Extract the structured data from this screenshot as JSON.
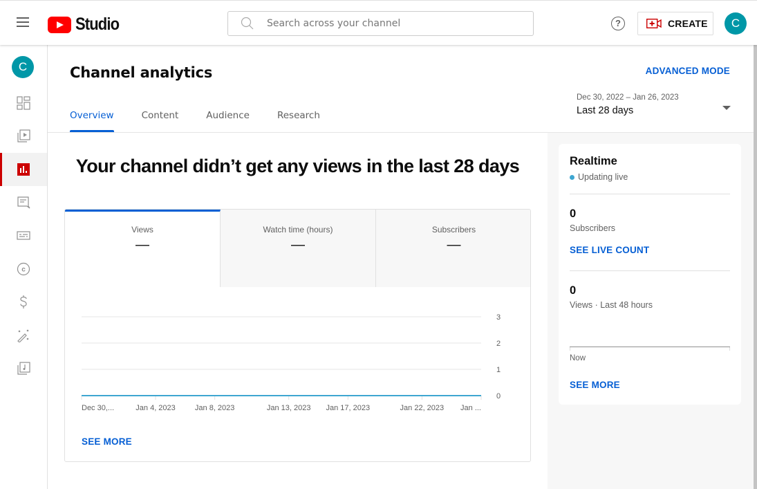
{
  "header": {
    "logo_text": "Studio",
    "search_placeholder": "Search across your channel",
    "create_label": "CREATE",
    "avatar_initial": "C",
    "colors": {
      "brand_red": "#ff0000",
      "accent_blue": "#065fd4",
      "avatar_teal": "#0097a7"
    }
  },
  "sidebar": {
    "avatar_initial": "C",
    "items": [
      {
        "name": "dashboard",
        "icon": "dashboard-icon",
        "active": false
      },
      {
        "name": "content",
        "icon": "video-library-icon",
        "active": false
      },
      {
        "name": "analytics",
        "icon": "analytics-icon",
        "active": true
      },
      {
        "name": "comments",
        "icon": "comments-icon",
        "active": false
      },
      {
        "name": "subtitles",
        "icon": "subtitles-icon",
        "active": false
      },
      {
        "name": "copyright",
        "icon": "copyright-icon",
        "active": false
      },
      {
        "name": "earn",
        "icon": "dollar-icon",
        "active": false
      },
      {
        "name": "customization",
        "icon": "magic-wand-icon",
        "active": false
      },
      {
        "name": "audio-library",
        "icon": "audio-library-icon",
        "active": false
      }
    ]
  },
  "page": {
    "title": "Channel analytics",
    "advanced_mode": "ADVANCED MODE",
    "tabs": [
      {
        "label": "Overview",
        "active": true
      },
      {
        "label": "Content",
        "active": false
      },
      {
        "label": "Audience",
        "active": false
      },
      {
        "label": "Research",
        "active": false
      }
    ],
    "date_range": "Dec 30, 2022 – Jan 26, 2023",
    "date_preset": "Last 28 days"
  },
  "overview": {
    "headline": "Your channel didn’t get any views in the last 28 days",
    "metrics": [
      {
        "label": "Views",
        "value": "—",
        "active": true
      },
      {
        "label": "Watch time (hours)",
        "value": "—",
        "active": false
      },
      {
        "label": "Subscribers",
        "value": "—",
        "active": false
      }
    ],
    "see_more": "SEE MORE"
  },
  "chart_data": {
    "type": "line",
    "title": "",
    "xlabel": "",
    "ylabel": "Views",
    "x_tick_labels": [
      "Dec 30,...",
      "Jan 4, 2023",
      "Jan 8, 2023",
      "Jan 13, 2023",
      "Jan 17, 2023",
      "Jan 22, 2023",
      "Jan ..."
    ],
    "x_tick_days": [
      0,
      5,
      9,
      14,
      18,
      23,
      27
    ],
    "y_ticks": [
      0,
      1,
      2,
      3
    ],
    "ylim": [
      0,
      3
    ],
    "grid": true,
    "series": [
      {
        "name": "Views",
        "color": "#3ea6d1",
        "x_days": [
          0,
          27
        ],
        "values": [
          0,
          0
        ]
      }
    ]
  },
  "realtime": {
    "title": "Realtime",
    "status": "Updating live",
    "subscribers_value": "0",
    "subscribers_label": "Subscribers",
    "see_live_count": "SEE LIVE COUNT",
    "views_value": "0",
    "views_label": "Views · Last 48 hours",
    "axis_end_label": "Now",
    "see_more": "SEE MORE"
  }
}
